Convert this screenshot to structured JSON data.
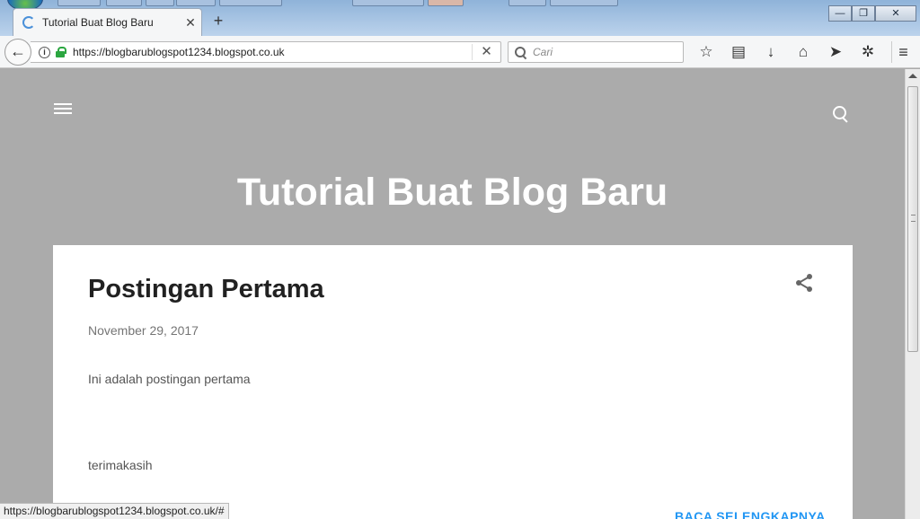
{
  "browser": {
    "active_tab": {
      "title": "Tutorial Buat Blog Baru",
      "close_glyph": "✕"
    },
    "new_tab_glyph": "+",
    "window_controls": {
      "minimize": "—",
      "maximize": "❐",
      "close": "✕"
    },
    "back_glyph": "←",
    "url": "https://blogbarublogspot1234.blogspot.co.uk",
    "url_clear_glyph": "✕",
    "search_placeholder": "Cari",
    "toolbar": {
      "bookmark_glyph": "☆",
      "reader_glyph": "▤",
      "download_glyph": "↓",
      "home_glyph": "⌂",
      "send_glyph": "➤",
      "extension_glyph": "✲",
      "menu_glyph": "≡"
    },
    "status_url": "https://blogbarublogspot1234.blogspot.co.uk/#"
  },
  "blog": {
    "title": "Tutorial Buat Blog Baru",
    "post": {
      "title": "Postingan Pertama",
      "date": "November 29, 2017",
      "body_line_1": "Ini adalah postingan pertama",
      "body_line_2": "terimakasih",
      "read_more": "BACA SELENGKAPNYA"
    }
  },
  "colors": {
    "page_background": "#ababab",
    "card_background": "#ffffff",
    "link_accent": "#2196f3",
    "secure_lock": "#2ba640"
  },
  "icons": [
    "info-icon",
    "lock-icon",
    "search-icon",
    "menu-icon",
    "share-icon",
    "hamburger-icon"
  ]
}
